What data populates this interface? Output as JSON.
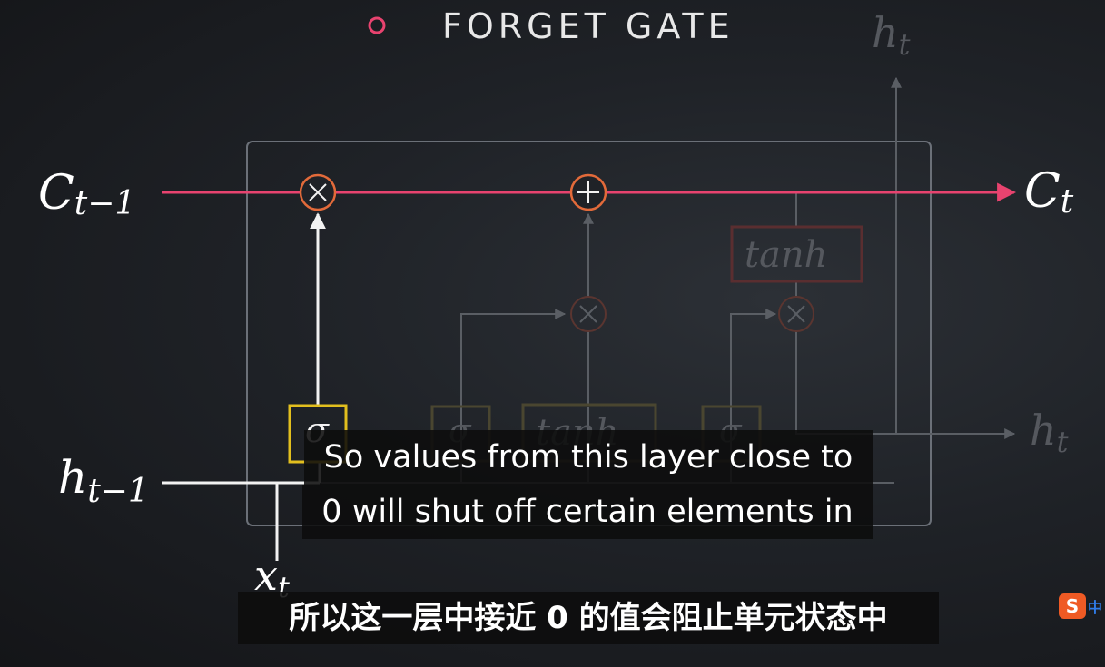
{
  "header": {
    "title": "FORGET GATE"
  },
  "diagram": {
    "labels": {
      "c_prev_main": "C",
      "c_prev_sub": "t−1",
      "c_next_main": "C",
      "c_next_sub": "t",
      "h_prev_main": "h",
      "h_prev_sub": "t−1",
      "h_out_main": "h",
      "h_out_sub": "t",
      "h_top_main": "h",
      "h_top_sub": "t",
      "x_main": "x",
      "x_sub": "t"
    },
    "gates": {
      "forget_sigma": "σ",
      "input_sigma": "σ",
      "candidate_tanh": "tanh",
      "output_sigma": "σ",
      "cell_tanh": "tanh"
    },
    "colors": {
      "cell_state": "#e8436f",
      "forget_gate": "#e2bf1e",
      "active_line": "#f2f2f2",
      "dim_line": "#5a5e64",
      "box": "#6b7078",
      "op_ring": "#e26a3a"
    }
  },
  "subtitles": {
    "en_line1": "So values from this layer close to",
    "en_line2": "0 will shut off certain elements in",
    "zh_line": "所以这一层中接近 0 的值会阻止单元状态中"
  },
  "ime": {
    "badge": "S",
    "lang": "中"
  }
}
